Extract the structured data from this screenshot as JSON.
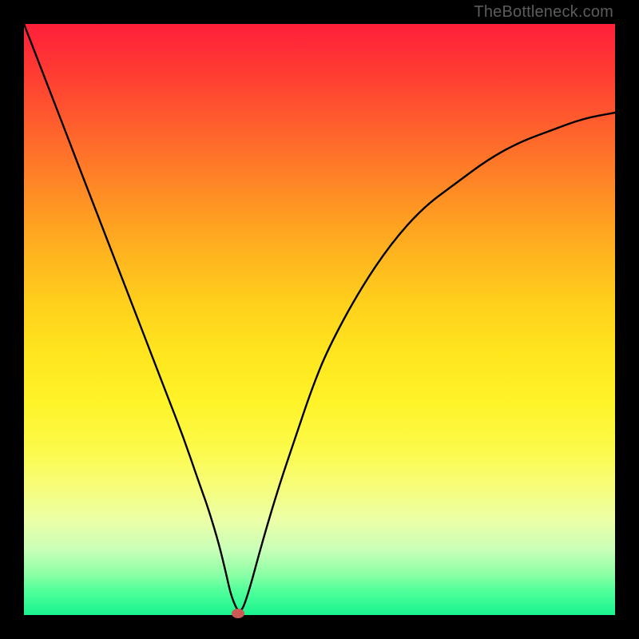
{
  "attribution": "TheBottleneck.com",
  "chart_data": {
    "type": "line",
    "title": "",
    "xlabel": "",
    "ylabel": "",
    "xlim": [
      0,
      100
    ],
    "ylim": [
      0,
      100
    ],
    "grid": false,
    "legend": false,
    "series": [
      {
        "name": "bottleneck-curve",
        "x": [
          0,
          2.7,
          5.4,
          8.1,
          10.8,
          13.5,
          16.2,
          18.9,
          21.6,
          24.3,
          27.0,
          29.4,
          31.2,
          33.0,
          34.2,
          35.1,
          36.5,
          37.8,
          40.5,
          43.2,
          45.9,
          48.6,
          51.4,
          56.8,
          62.2,
          67.6,
          73.0,
          78.4,
          83.8,
          89.2,
          94.6,
          100.0
        ],
        "y": [
          100,
          93,
          86,
          79,
          72,
          65,
          58,
          51,
          44,
          37,
          30,
          23,
          18,
          12,
          7,
          3,
          0,
          3,
          13,
          22,
          30,
          38,
          45,
          55,
          63,
          69,
          73,
          77,
          80,
          82,
          84,
          85
        ]
      }
    ],
    "marker": {
      "x": 36.2,
      "y": 0,
      "color": "#cc5a54"
    },
    "background_gradient": {
      "top": "#ff1f3a",
      "bottom": "#19f48f"
    }
  }
}
